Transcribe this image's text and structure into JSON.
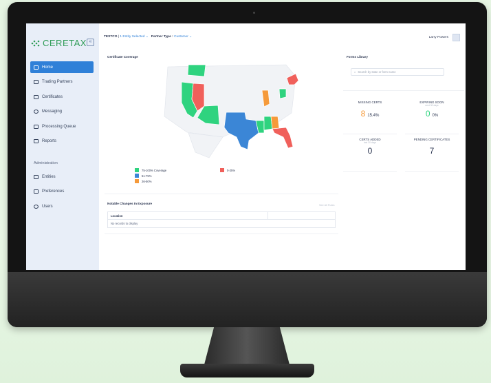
{
  "app": {
    "logo_text": "CERETAX",
    "collapse_icon": "«"
  },
  "sidebar": {
    "items": [
      {
        "label": "Home",
        "icon": "home-icon",
        "active": true
      },
      {
        "label": "Trading Partners",
        "icon": "trading-partners-icon"
      },
      {
        "label": "Certificates",
        "icon": "certificate-icon"
      },
      {
        "label": "Messaging",
        "icon": "messaging-icon"
      },
      {
        "label": "Processing Queue",
        "icon": "queue-icon"
      },
      {
        "label": "Reports",
        "icon": "reports-icon"
      }
    ],
    "admin_heading": "Administration",
    "admin_items": [
      {
        "label": "Entities",
        "icon": "entities-icon"
      },
      {
        "label": "Preferences",
        "icon": "preferences-icon"
      },
      {
        "label": "Users",
        "icon": "users-icon"
      }
    ]
  },
  "topbar": {
    "company": "TESTCO",
    "separator": "|",
    "entity_selector": "1 Entity Selected",
    "partner_type_label": "Partner Type :",
    "partner_type_value": "Customer",
    "user_name": "Larry Powers"
  },
  "coverage": {
    "title": "Certificate Coverage",
    "legend": [
      {
        "label": "75-100% Coverage",
        "color": "#2fd37f"
      },
      {
        "label": "51-75%",
        "color": "#3b86d6"
      },
      {
        "label": "26-50%",
        "color": "#f59a3a"
      },
      {
        "label": "0-25%",
        "color": "#f0605b"
      }
    ]
  },
  "notable": {
    "title": "Notable Changes In Exposure",
    "link": "See All Rules",
    "column_header": "Location",
    "empty_text": "No records to display"
  },
  "forms_library": {
    "title": "Forms Library",
    "search_placeholder": "Search by state or form name"
  },
  "stats": {
    "missing": {
      "label": "MISSING CERTS",
      "value": "8",
      "percent": "15.4%",
      "color": "#f59a3a"
    },
    "expiring": {
      "label": "EXPIRING SOON",
      "sublabel": "next 30 days",
      "value": "0",
      "percent": "0%",
      "color": "#2fd37f"
    },
    "added": {
      "label": "CERTS ADDED",
      "sublabel": "last 30 days",
      "value": "0"
    },
    "pending": {
      "label": "PENDING CERTIFICATES",
      "value": "7"
    }
  }
}
